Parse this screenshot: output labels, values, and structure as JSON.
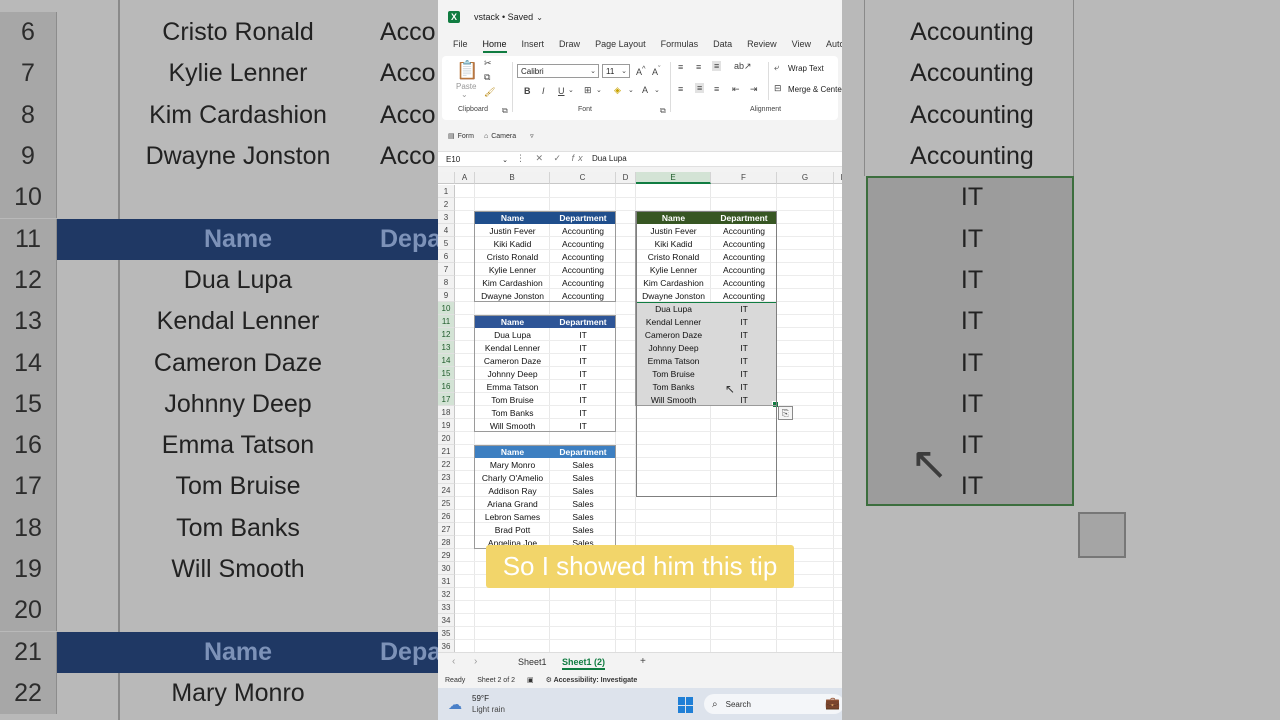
{
  "window": {
    "title": "vstack • Saved"
  },
  "menu": [
    "File",
    "Home",
    "Insert",
    "Draw",
    "Page Layout",
    "Formulas",
    "Data",
    "Review",
    "View",
    "Automate"
  ],
  "ribbon": {
    "paste_label": "Paste",
    "font_name": "Calibri",
    "font_size": "11",
    "wrap_text": "Wrap Text",
    "merge": "Merge & Cente",
    "groups": {
      "clipboard": "Clipboard",
      "font": "Font",
      "alignment": "Alignment"
    }
  },
  "quick_access": {
    "form": "Form",
    "camera": "Camera"
  },
  "formula_bar": {
    "name_box": "E10",
    "value": "Dua Lupa"
  },
  "grid": {
    "columns": [
      "A",
      "B",
      "C",
      "D",
      "E",
      "F",
      "G",
      "H"
    ],
    "selected_column": "E",
    "row_numbers": [
      "1",
      "2",
      "3",
      "4",
      "5",
      "6",
      "7",
      "8",
      "9",
      "10",
      "11",
      "12",
      "13",
      "14",
      "15",
      "16",
      "17",
      "18",
      "19",
      "20",
      "21",
      "22",
      "23",
      "24",
      "25",
      "26",
      "27",
      "28",
      "29",
      "30",
      "31",
      "32",
      "33",
      "34",
      "35",
      "36"
    ]
  },
  "tables": {
    "headers": {
      "name": "Name",
      "department": "Department"
    },
    "accounting": [
      {
        "name": "Justin Fever",
        "dept": "Accounting"
      },
      {
        "name": "Kiki Kadid",
        "dept": "Accounting"
      },
      {
        "name": "Cristo Ronald",
        "dept": "Accounting"
      },
      {
        "name": "Kylie Lenner",
        "dept": "Accounting"
      },
      {
        "name": "Kim Cardashion",
        "dept": "Accounting"
      },
      {
        "name": "Dwayne Jonston",
        "dept": "Accounting"
      }
    ],
    "it": [
      {
        "name": "Dua Lupa",
        "dept": "IT"
      },
      {
        "name": "Kendal Lenner",
        "dept": "IT"
      },
      {
        "name": "Cameron Daze",
        "dept": "IT"
      },
      {
        "name": "Johnny Deep",
        "dept": "IT"
      },
      {
        "name": "Emma Tatson",
        "dept": "IT"
      },
      {
        "name": "Tom Bruise",
        "dept": "IT"
      },
      {
        "name": "Tom Banks",
        "dept": "IT"
      },
      {
        "name": "Will Smooth",
        "dept": "IT"
      }
    ],
    "sales": [
      {
        "name": "Mary Monro",
        "dept": "Sales"
      },
      {
        "name": "Charly O'Amelio",
        "dept": "Sales"
      },
      {
        "name": "Addison Ray",
        "dept": "Sales"
      },
      {
        "name": "Ariana Grand",
        "dept": "Sales"
      },
      {
        "name": "Lebron Sames",
        "dept": "Sales"
      },
      {
        "name": "Brad Pott",
        "dept": "Sales"
      },
      {
        "name": "Angelina Joe",
        "dept": "Sales"
      }
    ]
  },
  "sheet_tabs": [
    "Sheet1",
    "Sheet1 (2)"
  ],
  "active_sheet": "Sheet1 (2)",
  "status": {
    "ready": "Ready",
    "sheet_info": "Sheet 2 of 2",
    "accessibility": "Accessibility: Investigate"
  },
  "taskbar": {
    "temp": "59°F",
    "weather": "Light rain",
    "search": "Search"
  },
  "caption": "So I showed him this tip",
  "colors": {
    "excel_green": "#107c41",
    "header_dark": "#1f4e8c",
    "header_mid": "#2e5597",
    "header_light": "#3d7fc1",
    "output_header": "#375623",
    "caption_bg": "#f2d56a"
  }
}
